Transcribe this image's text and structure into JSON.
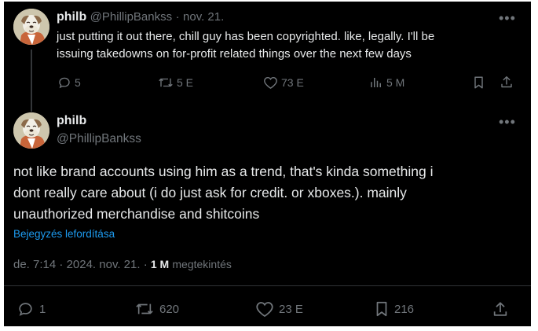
{
  "reply_tweet": {
    "display_name": "philb",
    "handle": "@PhillipBankss",
    "separator": "·",
    "date": "nov. 21.",
    "text_lines": [
      "just putting it out there, chill guy has been copyrighted. like, legally. I'll be",
      "issuing takedowns on for-profit related things over the next few days"
    ],
    "actions": {
      "replies": "5",
      "reposts": "5 E",
      "likes": "73 E",
      "views": "5 M"
    },
    "icons": {
      "more": "more-horizontal-icon",
      "reply": "reply-icon",
      "repost": "repost-icon",
      "like": "like-icon",
      "views": "views-icon",
      "bookmark": "bookmark-icon",
      "share": "share-icon"
    }
  },
  "main_tweet": {
    "display_name": "philb",
    "handle": "@PhillipBankss",
    "text_lines": [
      "not like brand accounts using him as a trend, that's kinda something i",
      "dont really care about (i do just ask for credit. or xboxes.). mainly",
      "unauthorized merchandise and shitcoins"
    ],
    "translate_link": "Bejegyzés lefordítása",
    "meta": {
      "time": "de. 7:14",
      "sep1": "·",
      "date": "2024. nov. 21.",
      "sep2": "·",
      "views_count": "1 M",
      "views_label": "megtekintés"
    },
    "actions": {
      "replies": "1",
      "reposts": "620",
      "likes": "23 E",
      "bookmarks": "216"
    }
  },
  "colors": {
    "background": "#000000",
    "text": "#e7e9ea",
    "muted": "#71767b",
    "link": "#1d9bf0",
    "divider": "#2f3336"
  }
}
